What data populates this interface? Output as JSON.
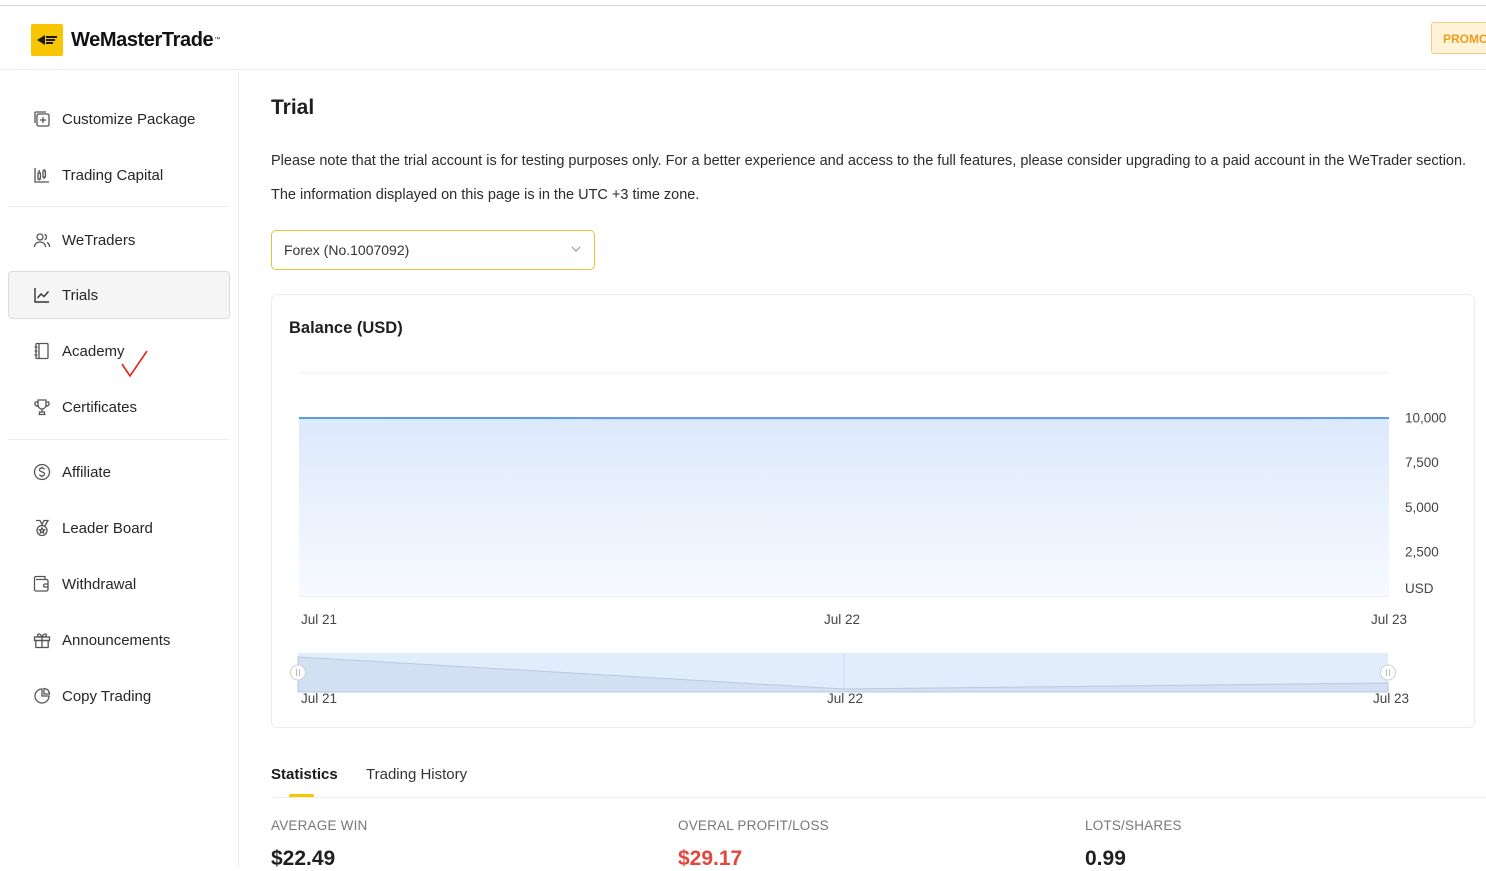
{
  "header": {
    "brand": "WeMasterTrade",
    "promo_label": "PROMO"
  },
  "sidebar": {
    "items": [
      {
        "label": "Customize Package",
        "icon": "add-package-icon"
      },
      {
        "label": "Trading Capital",
        "icon": "capital-chart-icon"
      },
      {
        "label": "WeTraders",
        "icon": "users-icon"
      },
      {
        "label": "Trials",
        "icon": "line-chart-icon",
        "active": true
      },
      {
        "label": "Academy",
        "icon": "book-icon"
      },
      {
        "label": "Certificates",
        "icon": "trophy-icon"
      },
      {
        "label": "Affiliate",
        "icon": "dollar-circle-icon"
      },
      {
        "label": "Leader Board",
        "icon": "medal-icon"
      },
      {
        "label": "Withdrawal",
        "icon": "wallet-icon"
      },
      {
        "label": "Announcements",
        "icon": "gift-icon"
      },
      {
        "label": "Copy Trading",
        "icon": "pie-chart-icon"
      }
    ]
  },
  "main": {
    "title": "Trial",
    "note_1": "Please note that the trial account is for testing purposes only. For a better experience and access to the full features, please consider upgrading to a paid account in the WeTrader section.",
    "note_2": "The information displayed on this page is in the UTC +3 time zone.",
    "account_select": {
      "value": "Forex (No.1007092)"
    },
    "balance_card_title": "Balance (USD)"
  },
  "chart_data": {
    "type": "area",
    "title": "Balance (USD)",
    "x": [
      "Jul 21",
      "Jul 22",
      "Jul 23"
    ],
    "series": [
      {
        "values": [
          9980,
          9970,
          9975
        ]
      }
    ],
    "y_ticks": [
      "10,000",
      "7,500",
      "5,000",
      "2,500"
    ],
    "y_unit_label": "USD",
    "ylim": [
      0,
      12500
    ],
    "grid": true,
    "brush": {
      "labels": [
        "Jul 21",
        "Jul 22",
        "Jul 23"
      ],
      "range": [
        0,
        1
      ]
    },
    "colors": {
      "line": "#5a9ae6",
      "fill": "#dce9fb"
    }
  },
  "tabs": [
    {
      "label": "Statistics",
      "active": true
    },
    {
      "label": "Trading History",
      "active": false
    }
  ],
  "stats": [
    {
      "label": "AVERAGE WIN",
      "value": "$22.49"
    },
    {
      "label": "OVERAL PROFIT/LOSS",
      "value": "$29.17"
    },
    {
      "label": "LOTS/SHARES",
      "value": "0.99"
    }
  ]
}
